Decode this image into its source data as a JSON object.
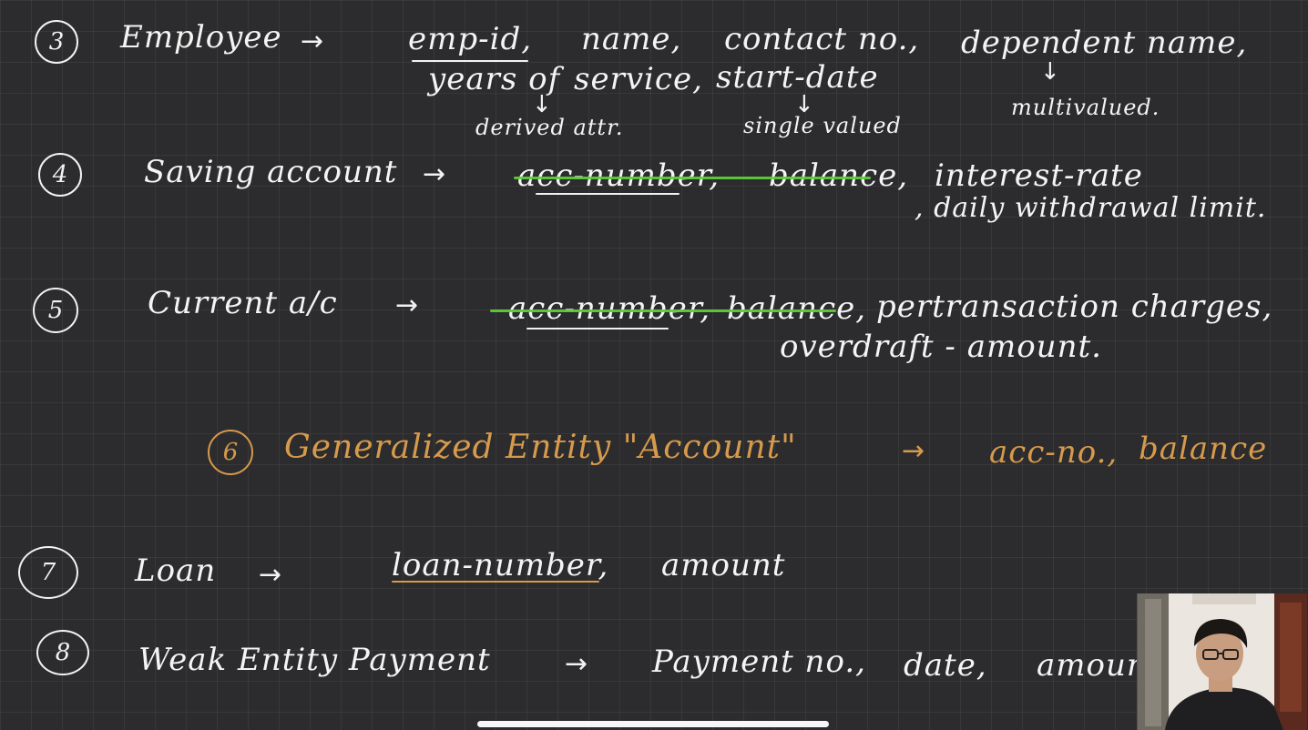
{
  "rows": {
    "r3": {
      "num": "3",
      "label": "Employee",
      "arrow": "→",
      "a1": "emp-id,",
      "a2": "name,",
      "a3": "contact no.,",
      "a4": "dependent name,",
      "b1": "years of",
      "b2": "service,",
      "b3": "start-date",
      "n1": "derived attr.",
      "n2": "single valued",
      "n3": "multivalued."
    },
    "r4": {
      "num": "4",
      "label": "Saving account",
      "arrow": "→",
      "a1": "acc-number,",
      "a2": "balance,",
      "a3": "interest-rate",
      "b1": ", daily withdrawal limit."
    },
    "r5": {
      "num": "5",
      "label": "Current a/c",
      "arrow": "→",
      "a1": "acc-number,",
      "a2": "balance,",
      "a3": "pertransaction charges,",
      "b1": "overdraft - amount."
    },
    "r6": {
      "num": "6",
      "label": "Generalized Entity \"Account\"",
      "arrow": "→",
      "a1": "acc-no.,",
      "a2": "balance"
    },
    "r7": {
      "num": "7",
      "label": "Loan",
      "arrow": "→",
      "a1": "loan-number,",
      "a2": "amount"
    },
    "r8": {
      "num": "8",
      "label": "Weak Entity Payment",
      "arrow": "→",
      "a1": "Payment no.,",
      "a2": "date,",
      "a3": "amoun"
    }
  },
  "icons": {
    "down_arrow": "down-arrow-icon"
  },
  "colors": {
    "background": "#2c2c2e",
    "ink": "#f4f4f4",
    "highlight": "#5fcc3a",
    "orange_ink": "#d69a4c"
  }
}
